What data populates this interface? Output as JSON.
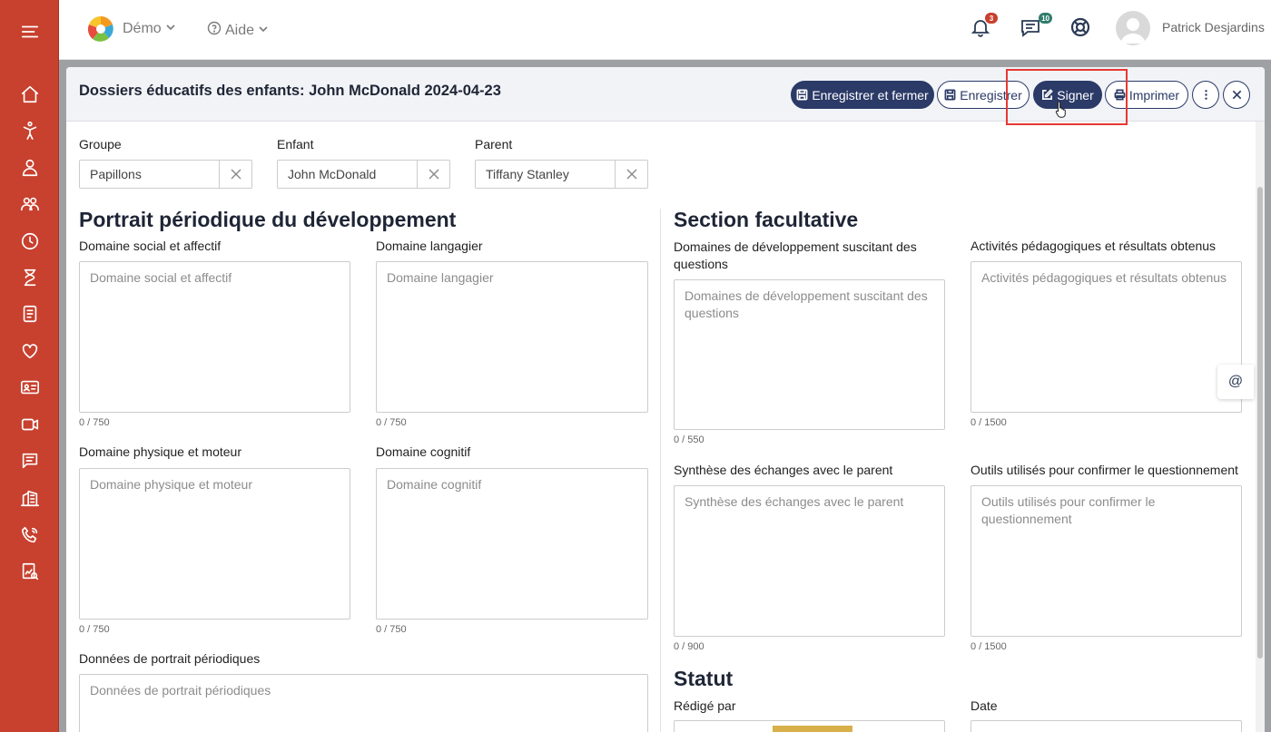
{
  "topbar": {
    "demo_label": "Démo",
    "aide_label": "Aide",
    "notifications_count": "3",
    "messages_count": "10",
    "user_name": "Patrick Desjardins"
  },
  "sidebar": {
    "items": [
      "menu-icon",
      "home-icon",
      "child-icon",
      "staff-icon",
      "group-icon",
      "clock-icon",
      "hourglass-icon",
      "document-icon",
      "heart-icon",
      "id-card-icon",
      "video-icon",
      "chat-icon",
      "building-icon",
      "phone-icon",
      "report-icon"
    ]
  },
  "header": {
    "title": "Dossiers éducatifs des enfants: John McDonald 2024-04-23",
    "save_close_label": "Enregistrer et fermer",
    "save_label": "Enregistrer",
    "sign_label": "Signer",
    "print_label": "Imprimer"
  },
  "selectors": {
    "groupe": {
      "label": "Groupe",
      "value": "Papillons"
    },
    "enfant": {
      "label": "Enfant",
      "value": "John McDonald"
    },
    "parent": {
      "label": "Parent",
      "value": "Tiffany Stanley"
    }
  },
  "portrait": {
    "title": "Portrait périodique du développement",
    "social": {
      "label": "Domaine social et affectif",
      "placeholder": "Domaine social et affectif",
      "counter": "0 / 750"
    },
    "langagier": {
      "label": "Domaine langagier",
      "placeholder": "Domaine langagier",
      "counter": "0 / 750"
    },
    "physique": {
      "label": "Domaine physique et moteur",
      "placeholder": "Domaine physique et moteur",
      "counter": "0 / 750"
    },
    "cognitif": {
      "label": "Domaine cognitif",
      "placeholder": "Domaine cognitif",
      "counter": "0 / 750"
    },
    "donnees": {
      "label": "Données de portrait périodiques",
      "placeholder": "Données de portrait périodiques"
    }
  },
  "facultative": {
    "title": "Section facultative",
    "domaines_label_1": "Domaines de développement suscitant des",
    "domaines_label_2": "questions",
    "domaines_placeholder": "Domaines de développement suscitant des questions",
    "domaines_counter": "0 / 550",
    "activites": {
      "label": "Activités pédagogiques et résultats obtenus",
      "placeholder": "Activités pédagogiques et résultats obtenus",
      "counter": "0 / 1500"
    },
    "synthese": {
      "label": "Synthèse des échanges avec le parent",
      "placeholder": "Synthèse des échanges avec le parent",
      "counter": "0 / 900"
    },
    "outils": {
      "label": "Outils utilisés pour confirmer le questionnement",
      "placeholder": "Outils utilisés pour confirmer le questionnement",
      "counter": "0 / 1500"
    }
  },
  "statut": {
    "title": "Statut",
    "redige_label": "Rédigé par",
    "date_label": "Date"
  },
  "misc": {
    "at_label": "@"
  },
  "colors": {
    "sidebar": "#c8402e",
    "primary": "#2b3a67",
    "highlight": "#e53935"
  }
}
